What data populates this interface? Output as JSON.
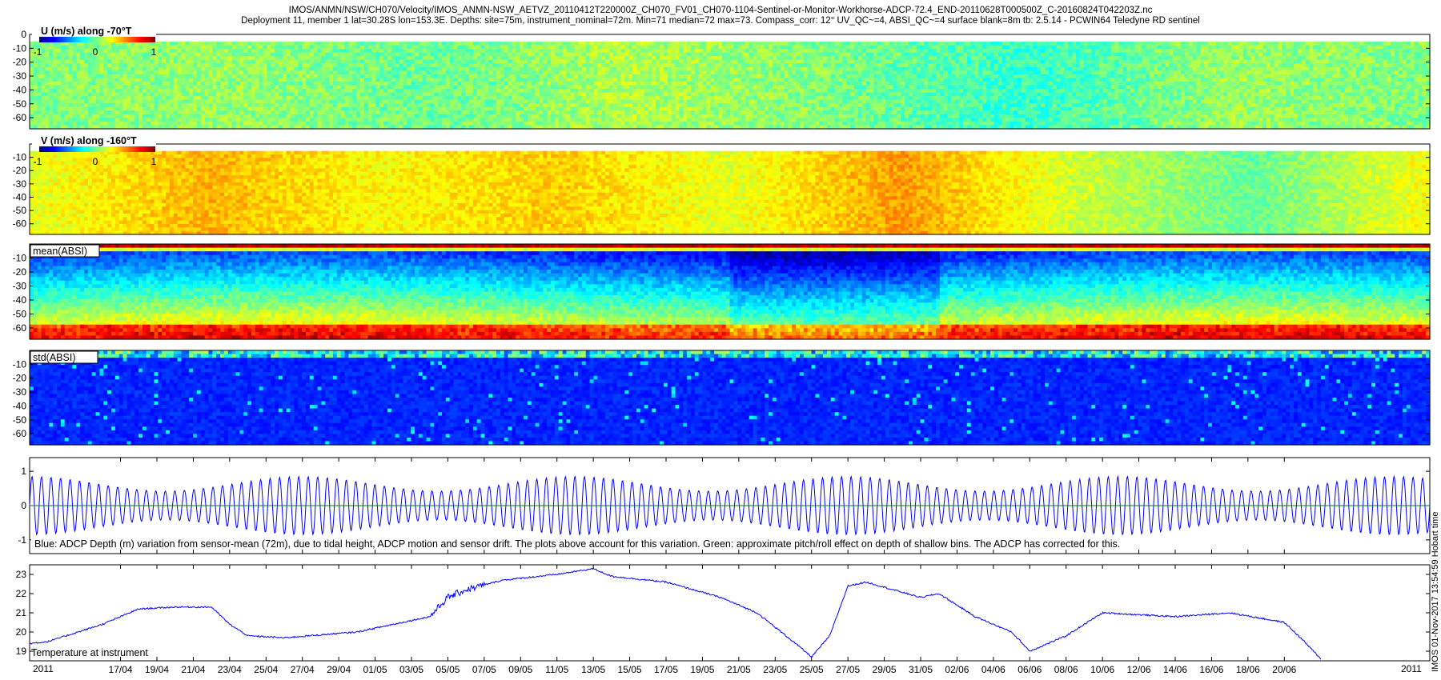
{
  "title_line1": "IMOS/ANMN/NSW/CH070/Velocity/IMOS_ANMN-NSW_AETVZ_20110412T220000Z_CH070_FV01_CH070-1104-Sentinel-or-Monitor-Workhorse-ADCP-72.4_END-20110628T000500Z_C-20160824T042203Z.nc",
  "title_line2": "Deployment 11, member 1 lat=30.28S lon=153.3E. Depths: site=75m, instrument_nominal=72m. Min=71 median=72 max=73. Compass_corr: 12° UV_QC~=4, ABSI_QC~=4 surface blank=8m tb: 2.5.14 - PCWIN64 Teledyne RD sentinel",
  "side_timestamp": "IMOS 01-Nov-2017 13:54:59 Hobart time",
  "chart_data": [
    {
      "type": "heatmap",
      "title": "U (m/s) along -70°T",
      "colorbar_ticks": [
        "-1",
        "0",
        "1"
      ],
      "ylim": [
        -68,
        0
      ],
      "yticks": [
        0,
        -10,
        -20,
        -30,
        -40,
        -50,
        -60
      ],
      "colormap": "jet",
      "mean_value_along_time": [
        0.0,
        0.05,
        -0.05,
        0.1,
        0.0,
        -0.15,
        0.05,
        0.0
      ]
    },
    {
      "type": "heatmap",
      "title": "V (m/s) along -160°T",
      "colorbar_ticks": [
        "-1",
        "0",
        "1"
      ],
      "ylim": [
        -68,
        0
      ],
      "yticks": [
        -10,
        -20,
        -30,
        -40,
        -50,
        -60
      ],
      "colormap": "jet",
      "mean_value_along_time": [
        0.2,
        0.6,
        0.3,
        0.5,
        0.2,
        0.7,
        0.1,
        -0.3,
        0.3
      ]
    },
    {
      "type": "heatmap",
      "title": "mean(ABSI)",
      "ylim": [
        -68,
        0
      ],
      "yticks": [
        -10,
        -20,
        -30,
        -40,
        -50,
        -60
      ],
      "colormap": "jet"
    },
    {
      "type": "heatmap",
      "title": "std(ABSI)",
      "ylim": [
        -68,
        0
      ],
      "yticks": [
        -10,
        -20,
        -30,
        -40,
        -50,
        -60
      ],
      "colormap": "jet"
    },
    {
      "type": "line",
      "caption": "Blue: ADCP Depth (m) variation from sensor-mean (72m), due to tidal height, ADCP motion and sensor drift. The plots above account for this variation. Green: approximate pitch/roll effect on depth of shallow bins. The ADCP has corrected for this.",
      "ylim": [
        -1.4,
        1.4
      ],
      "yticks": [
        1,
        0,
        -1
      ],
      "series": [
        {
          "color": "#0000ff",
          "amplitude_m": 0.85,
          "period_days": 0.517
        },
        {
          "color": "#008000",
          "values": [
            0,
            0,
            0,
            0,
            0,
            0
          ]
        }
      ]
    },
    {
      "type": "line",
      "caption": "Temperature at instrument",
      "ylim": [
        18.5,
        23.5
      ],
      "yticks": [
        23,
        22,
        21,
        20,
        19
      ],
      "x": [
        "2011-04-12",
        "2011-04-13",
        "2011-04-16",
        "2011-04-18",
        "2011-04-20",
        "2011-04-22",
        "2011-04-23",
        "2011-04-24",
        "2011-04-26",
        "2011-04-30",
        "2011-05-02",
        "2011-05-04",
        "2011-05-05",
        "2011-05-06",
        "2011-05-08",
        "2011-05-11",
        "2011-05-13",
        "2011-05-14",
        "2011-05-17",
        "2011-05-20",
        "2011-05-22",
        "2011-05-24",
        "2011-05-25",
        "2011-05-26",
        "2011-05-27",
        "2011-05-28",
        "2011-05-31",
        "2011-06-01",
        "2011-06-03",
        "2011-06-05",
        "2011-06-06",
        "2011-06-08",
        "2011-06-09",
        "2011-06-10",
        "2011-06-14",
        "2011-06-17",
        "2011-06-20",
        "2011-06-21",
        "2011-06-22"
      ],
      "y": [
        19.4,
        19.5,
        20.4,
        21.2,
        21.3,
        21.3,
        20.4,
        19.8,
        19.7,
        20.0,
        20.4,
        20.8,
        21.8,
        22.2,
        22.7,
        23.0,
        23.3,
        22.9,
        22.6,
        21.8,
        21.0,
        19.5,
        18.7,
        19.8,
        22.4,
        22.6,
        21.8,
        22.0,
        20.8,
        20.0,
        19.0,
        19.8,
        20.4,
        21.0,
        20.8,
        21.0,
        20.5,
        19.6,
        18.6
      ],
      "xticks": [
        "17/04",
        "19/04",
        "21/04",
        "23/04",
        "25/04",
        "27/04",
        "29/04",
        "01/05",
        "03/05",
        "05/05",
        "07/05",
        "09/05",
        "11/05",
        "13/05",
        "15/05",
        "17/05",
        "19/05",
        "21/05",
        "23/05",
        "25/05",
        "27/05",
        "29/05",
        "31/05",
        "02/06",
        "04/06",
        "06/06",
        "08/06",
        "10/06",
        "12/06",
        "14/06",
        "16/06",
        "18/06",
        "20/06"
      ],
      "x_start_label": "2011",
      "x_end_label": "2011",
      "series": [
        {
          "color": "#0000ff"
        }
      ]
    }
  ]
}
